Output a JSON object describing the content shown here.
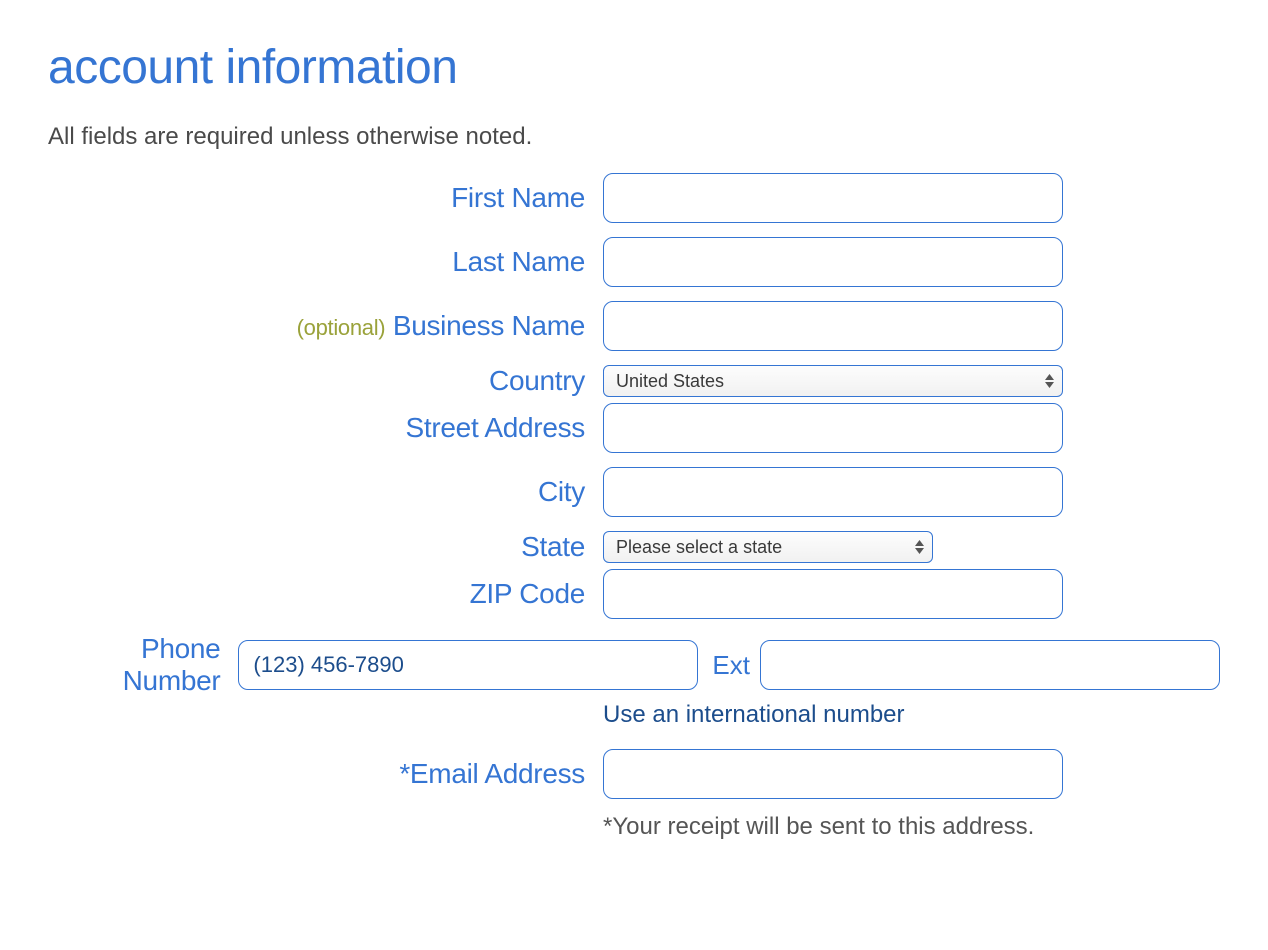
{
  "heading": "account information",
  "sub_note": "All fields are required unless otherwise noted.",
  "labels": {
    "first_name": "First Name",
    "last_name": "Last Name",
    "business_name": "Business Name",
    "optional": "(optional)",
    "country": "Country",
    "street_address": "Street Address",
    "city": "City",
    "state": "State",
    "zip": "ZIP Code",
    "phone": "Phone Number",
    "ext": "Ext",
    "email": "*Email Address"
  },
  "select": {
    "country": "United States",
    "state": "Please select a state"
  },
  "fields": {
    "first_name": "",
    "last_name": "",
    "business_name": "",
    "street_address": "",
    "city": "",
    "zip": "",
    "phone": "",
    "phone_placeholder": "(123) 456-7890",
    "ext": "",
    "email": ""
  },
  "links": {
    "intl": "Use an international number"
  },
  "foot_note": "*Your receipt will be sent to this address."
}
